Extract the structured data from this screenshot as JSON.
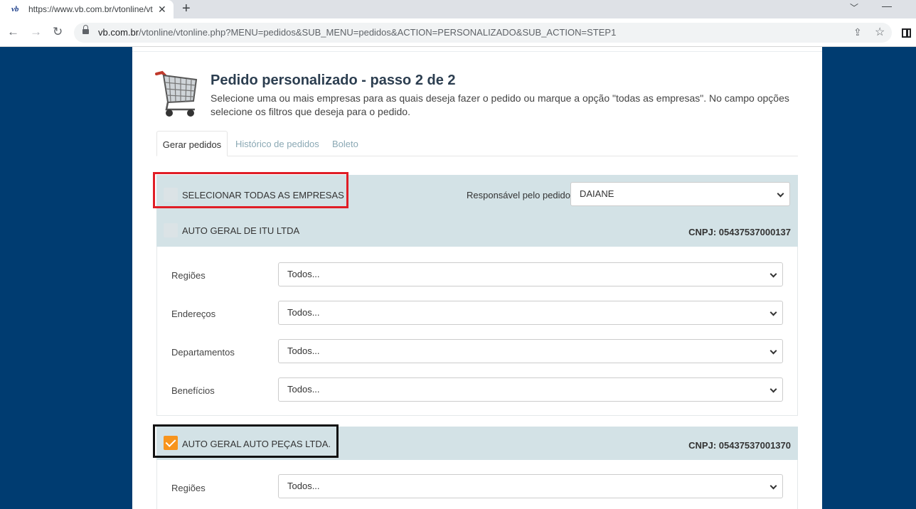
{
  "browser": {
    "tab_favicon": "vb",
    "tab_title": "https://www.vb.com.br/vtonline/vt",
    "url_host": "vb.com.br",
    "url_path": "/vtonline/vtonline.php?MENU=pedidos&SUB_MENU=pedidos&ACTION=PERSONALIZADO&SUB_ACTION=STEP1"
  },
  "header": {
    "title": "Pedido personalizado - passo 2 de 2",
    "description": "Selecione uma ou mais empresas para as quais deseja fazer o pedido ou marque a opção \"todas as empresas\". No campo opções selecione os filtros que deseja para o pedido."
  },
  "tabs": [
    {
      "label": "Gerar pedidos",
      "active": true
    },
    {
      "label": "Histórico de pedidos",
      "active": false
    },
    {
      "label": "Boleto",
      "active": false
    }
  ],
  "select_all": {
    "label": "SELECIONAR TODAS AS EMPRESAS",
    "checked": false,
    "responsavel_label": "Responsável pelo pedido",
    "responsavel_value": "DAIANE"
  },
  "companies": [
    {
      "name": "AUTO GERAL DE ITU LTDA",
      "cnpj": "CNPJ: 05437537000137",
      "checked": false,
      "filters": [
        {
          "label": "Regiões",
          "value": "Todos..."
        },
        {
          "label": "Endereços",
          "value": "Todos..."
        },
        {
          "label": "Departamentos",
          "value": "Todos..."
        },
        {
          "label": "Benefícios",
          "value": "Todos..."
        }
      ]
    },
    {
      "name": "AUTO GERAL AUTO PEÇAS LTDA.",
      "cnpj": "CNPJ: 05437537001370",
      "checked": true,
      "filters": [
        {
          "label": "Regiões",
          "value": "Todos..."
        }
      ]
    }
  ],
  "colors": {
    "page_background": "#003c71",
    "accent_orange": "#f7941d",
    "company_header": "#d3e2e6",
    "highlight_red": "#e01e26"
  }
}
